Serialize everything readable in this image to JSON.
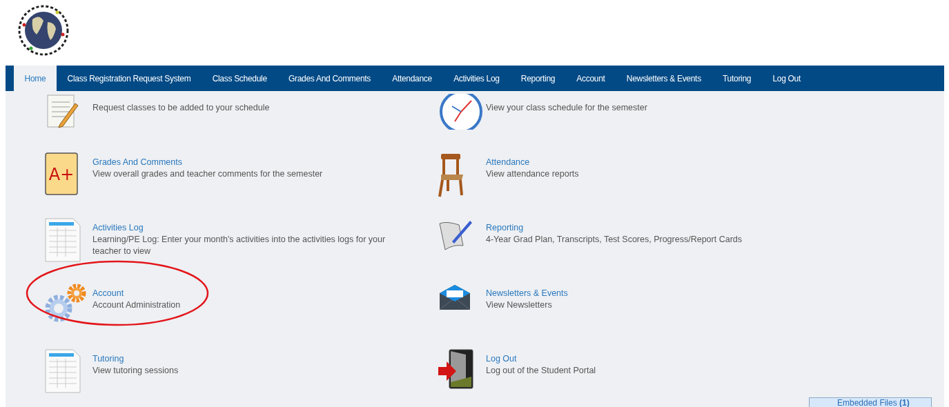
{
  "nav": [
    {
      "label": "Home",
      "selected": true
    },
    {
      "label": "Class Registration Request System",
      "selected": false
    },
    {
      "label": "Class Schedule",
      "selected": false
    },
    {
      "label": "Grades And Comments",
      "selected": false
    },
    {
      "label": "Attendance",
      "selected": false
    },
    {
      "label": "Activities Log",
      "selected": false
    },
    {
      "label": "Reporting",
      "selected": false
    },
    {
      "label": "Account",
      "selected": false
    },
    {
      "label": "Newsletters & Events",
      "selected": false
    },
    {
      "label": "Tutoring",
      "selected": false
    },
    {
      "label": "Log Out",
      "selected": false
    }
  ],
  "items": [
    {
      "description": "Request classes to be added to your schedule",
      "highlighted": false
    },
    {
      "description": "View your class schedule for the semester",
      "highlighted": false
    },
    {
      "title": "Grades And Comments",
      "description": "View overall grades and teacher comments for the semester",
      "highlighted": false,
      "icon_text": "A+"
    },
    {
      "title": "Attendance",
      "description": "View attendance reports",
      "highlighted": false
    },
    {
      "title": "Activities Log",
      "description": "Learning/PE Log: Enter your month's activities into the activities logs for your teacher to view",
      "highlighted": false
    },
    {
      "title": "Reporting",
      "description": "4-Year Grad Plan, Transcripts, Test Scores, Progress/Report Cards",
      "highlighted": false
    },
    {
      "title": "Account",
      "description": "Account Administration",
      "highlighted": true
    },
    {
      "title": "Newsletters & Events",
      "description": "View Newsletters",
      "highlighted": false
    },
    {
      "title": "Tutoring",
      "description": "View tutoring sessions",
      "highlighted": false
    },
    {
      "title": "Log Out",
      "description": "Log out of the Student Portal",
      "highlighted": false
    }
  ],
  "embedded_files": {
    "label": "Embedded Files",
    "count": "(1)"
  }
}
